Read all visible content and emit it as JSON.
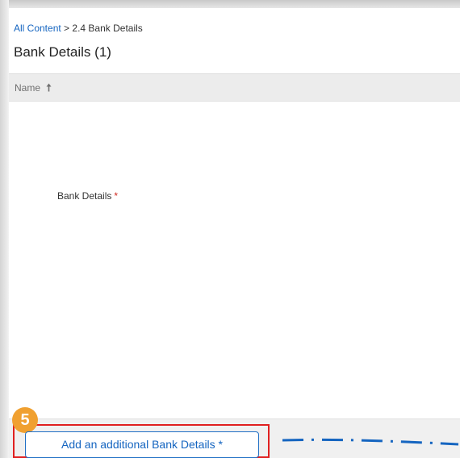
{
  "breadcrumb": {
    "root_label": "All Content",
    "separator": ">",
    "current_label": "2.4 Bank Details"
  },
  "section": {
    "title": "Bank Details (1)"
  },
  "table": {
    "columns": [
      {
        "label": "Name",
        "sort": "ascending",
        "sort_icon": "arrow-up-icon"
      }
    ]
  },
  "field": {
    "label": "Bank Details",
    "required_marker": "*"
  },
  "footer": {
    "add_button_label": "Add an additional Bank Details *"
  },
  "annotation": {
    "step_number": "5",
    "step_color": "#f0a030",
    "highlight_color": "#e02020",
    "connector_color": "#1565c0"
  },
  "colors": {
    "link": "#1565c0",
    "required": "#d0271d",
    "header_bg": "#ececec"
  }
}
